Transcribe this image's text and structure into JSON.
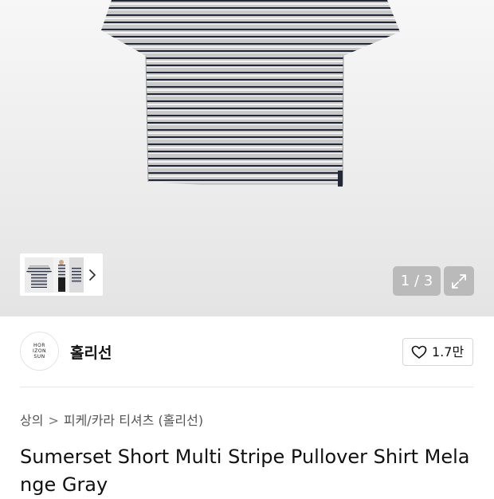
{
  "gallery": {
    "counter": "1 / 3",
    "current_page": 1,
    "total_pages": 3
  },
  "brand": {
    "logo_lines": [
      "HOR",
      "IZON",
      "SUN"
    ],
    "name": "홀리선"
  },
  "like": {
    "count": "1.7만"
  },
  "breadcrumb": {
    "items": [
      "상의",
      "피케/카라 티셔츠 (홀리선)"
    ],
    "separator": ">"
  },
  "product": {
    "title": "Sumerset Short Multi Stripe Pullover Shirt Melange Gray"
  },
  "colors": {
    "shirt_base": "#c8c8c8",
    "stripe_dark": "#232838",
    "stripe_white": "#f3f3f3",
    "accent_text": "#111111"
  }
}
